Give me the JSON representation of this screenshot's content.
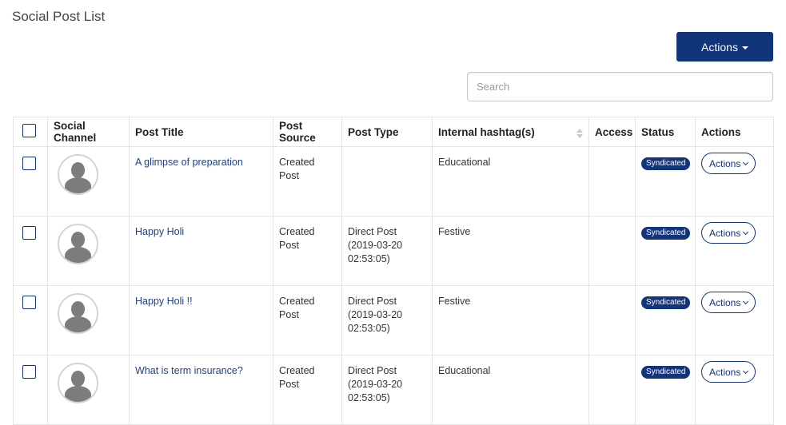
{
  "page": {
    "title": "Social Post List"
  },
  "toolbar": {
    "actions_label": "Actions"
  },
  "search": {
    "placeholder": "Search",
    "value": ""
  },
  "table": {
    "headers": {
      "social_channel": "Social Channel",
      "post_title": "Post Title",
      "post_source": "Post Source",
      "post_type": "Post Type",
      "internal_hashtags": "Internal hashtag(s)",
      "access": "Access",
      "status": "Status",
      "actions": "Actions"
    },
    "rows": [
      {
        "title": "A glimpse of preparation",
        "source": "Created Post",
        "type": "",
        "type_time": "",
        "hashtags": "Educational",
        "access": "",
        "status": "Syndicated",
        "action_label": "Actions"
      },
      {
        "title": "Happy Holi",
        "source": "Created Post",
        "type": "Direct Post",
        "type_time": "(2019-03-20 02:53:05)",
        "hashtags": "Festive",
        "access": "",
        "status": "Syndicated",
        "action_label": "Actions"
      },
      {
        "title": "Happy Holi !!",
        "source": "Created Post",
        "type": "Direct Post",
        "type_time": "(2019-03-20 02:53:05)",
        "hashtags": "Festive",
        "access": "",
        "status": "Syndicated",
        "action_label": "Actions"
      },
      {
        "title": "What is term insurance?",
        "source": "Created Post",
        "type": "Direct Post",
        "type_time": "(2019-03-20 02:53:05)",
        "hashtags": "Educational",
        "access": "",
        "status": "Syndicated",
        "action_label": "Actions"
      }
    ]
  },
  "colors": {
    "primary": "#12347a",
    "link": "#1f3f86",
    "border": "#e3e3e3"
  },
  "icons": {
    "select_all": "checkbox-icon",
    "avatar": "user-avatar-icon",
    "sort": "sort-icon",
    "dropdown": "chevron-down-icon"
  }
}
